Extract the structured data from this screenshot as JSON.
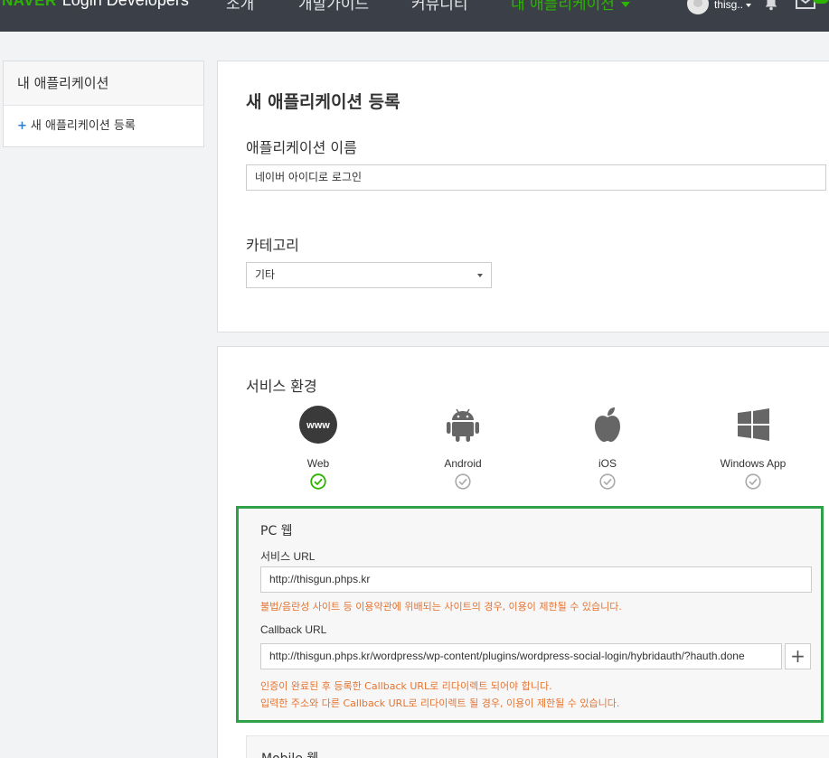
{
  "brand": {
    "naver": "NAVER",
    "product": "Login Developers"
  },
  "nav": {
    "items": [
      {
        "label": "소개"
      },
      {
        "label": "개발가이드"
      },
      {
        "label": "커뮤니티"
      },
      {
        "label": "내 애플리케이션"
      }
    ],
    "active_index": 3
  },
  "user": {
    "name": "thisg.."
  },
  "colors": {
    "nav_bg": "#3b3f48",
    "accent": "#2db400",
    "highlight_border": "#2fa148",
    "warning": "#e57431"
  },
  "sidebar": {
    "title": "내 애플리케이션",
    "items": [
      {
        "icon": "plus-icon",
        "symbol": "+",
        "label": "새 애플리케이션 등록"
      }
    ]
  },
  "form": {
    "page_title": "새 애플리케이션 등록",
    "app_name_label": "애플리케이션 이름",
    "app_name_value": "네이버 아이디로 로그인",
    "category_label": "카테고리",
    "category_value": "기타"
  },
  "service_env": {
    "title": "서비스 환경",
    "platforms": [
      {
        "label": "Web",
        "icon": "www-icon",
        "checked": true
      },
      {
        "label": "Android",
        "icon": "android-icon",
        "checked": false
      },
      {
        "label": "iOS",
        "icon": "apple-icon",
        "checked": false
      },
      {
        "label": "Windows App",
        "icon": "windows-icon",
        "checked": false
      }
    ]
  },
  "pc_web": {
    "title": "PC 웹",
    "service_url_label": "서비스 URL",
    "service_url_value": "http://thisgun.phps.kr",
    "service_url_warning": "불법/음란성 사이트 등 이용약관에 위배되는 사이트의 경우, 이용이 제한될 수 있습니다.",
    "callback_label": "Callback URL",
    "callback_value": "http://thisgun.phps.kr/wordpress/wp-content/plugins/wordpress-social-login/hybridauth/?hauth.done",
    "callback_add_symbol": "+",
    "callback_warning_1": "인증이 완료된 후 등록한 Callback URL로 리다이렉트 되어야 합니다.",
    "callback_warning_2": "입력한 주소와 다른 Callback URL로 리다이렉트 될 경우, 이용이 제한될 수 있습니다."
  },
  "mobile_web": {
    "title": "Mobile 웹"
  }
}
